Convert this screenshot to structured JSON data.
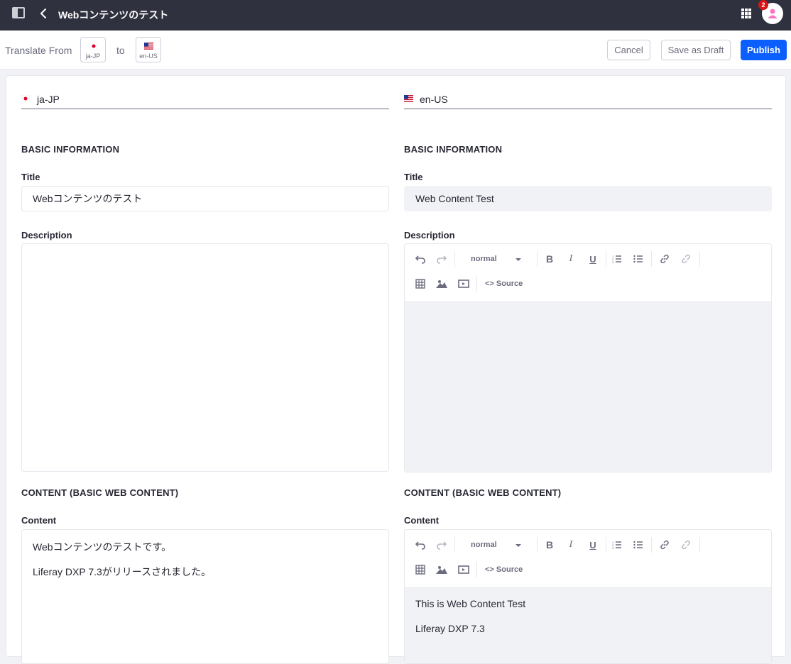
{
  "header": {
    "title": "Webコンテンツのテスト",
    "notification_count": "2"
  },
  "toolbar": {
    "translate_from": "Translate From",
    "to": "to",
    "source_lang": "ja-JP",
    "target_lang": "en-US",
    "cancel": "Cancel",
    "save_draft": "Save as Draft",
    "publish": "Publish"
  },
  "left": {
    "lang": "ja-JP",
    "section_basic": "BASIC INFORMATION",
    "title_label": "Title",
    "title_value": "Webコンテンツのテスト",
    "description_label": "Description",
    "section_content": "CONTENT (BASIC WEB CONTENT)",
    "content_label": "Content",
    "content_lines": [
      "Webコンテンツのテストです。",
      "Liferay DXP 7.3がリリースされました。"
    ]
  },
  "right": {
    "lang": "en-US",
    "section_basic": "BASIC INFORMATION",
    "title_label": "Title",
    "title_value": "Web Content Test",
    "description_label": "Description",
    "section_content": "CONTENT (BASIC WEB CONTENT)",
    "content_label": "Content",
    "content_lines": [
      "This is Web Content Test",
      "Liferay DXP 7.3"
    ]
  },
  "editor": {
    "format_value": "normal",
    "source_label": "Source",
    "tools": [
      "undo-icon",
      "redo-icon",
      "bold-icon",
      "italic-icon",
      "underline-icon",
      "ordered-list-icon",
      "unordered-list-icon",
      "link-icon",
      "unlink-icon",
      "table-icon",
      "image-icon",
      "video-icon",
      "code-icon"
    ]
  },
  "colors": {
    "topbar": "#30313f",
    "primary": "#0b5fff",
    "badge": "#da1414",
    "avatar_icon": "#ff73c3"
  }
}
